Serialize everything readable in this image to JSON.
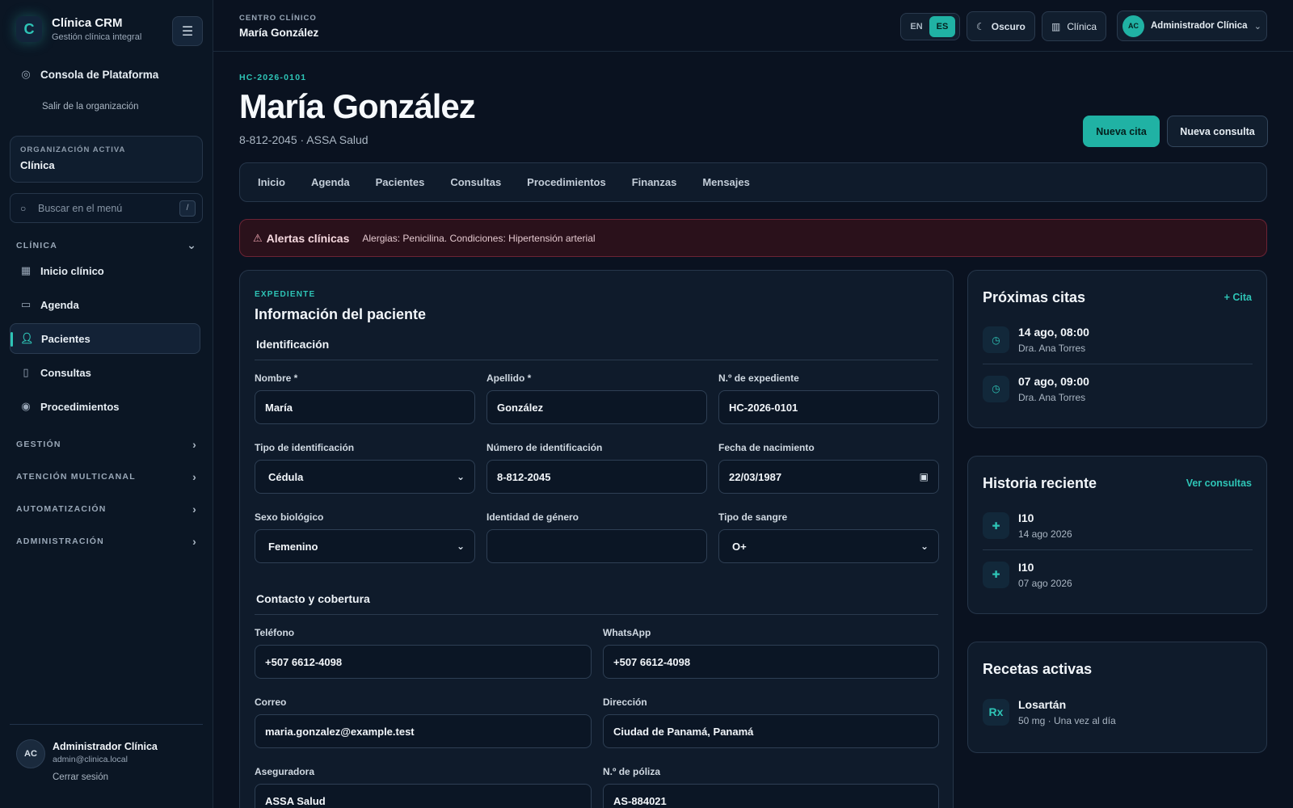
{
  "sidebar": {
    "brand_title": "Clínica CRM",
    "brand_subtitle": "Gestión clínica integral",
    "platform_console": "Consola de Plataforma",
    "leave_org": "Salir de la organización",
    "org_label": "ORGANIZACIÓN ACTIVA",
    "org_value": "Clínica",
    "search_placeholder": "Buscar en el menú",
    "search_shortcut": "/",
    "clinic_section": "CLÍNICA",
    "clinic_items": [
      {
        "label": "Inicio clínico",
        "icon": "grid-icon"
      },
      {
        "label": "Agenda",
        "icon": "calendar-icon"
      },
      {
        "label": "Pacientes",
        "icon": "user-icon"
      },
      {
        "label": "Consultas",
        "icon": "document-icon"
      },
      {
        "label": "Procedimientos",
        "icon": "check-circle-icon"
      }
    ],
    "sections": [
      "GESTIÓN",
      "ATENCIÓN MULTICANAL",
      "AUTOMATIZACIÓN",
      "ADMINISTRACIÓN"
    ],
    "user": {
      "initials": "AC",
      "name": "Administrador Clínica",
      "email": "admin@clinica.local",
      "logout": "Cerrar sesión"
    }
  },
  "topbar": {
    "kicker": "CENTRO CLÍNICO",
    "title": "María González",
    "lang_en": "EN",
    "lang_es": "ES",
    "theme_label": "Oscuro",
    "clinic_label": "Clínica",
    "user_initials": "AC",
    "user_name": "Administrador Clínica"
  },
  "patient": {
    "record": "HC-2026-0101",
    "name": "María González",
    "subtitle": "8-812-2045 · ASSA Salud",
    "new_appointment": "Nueva cita",
    "new_consultation": "Nueva consulta"
  },
  "tabs": [
    "Inicio",
    "Agenda",
    "Pacientes",
    "Consultas",
    "Procedimientos",
    "Finanzas",
    "Mensajes"
  ],
  "alert": {
    "title": "Alertas clínicas",
    "text": "Alergias: Penicilina. Condiciones: Hipertensión arterial"
  },
  "form": {
    "kicker": "EXPEDIENTE",
    "title": "Información del paciente",
    "identification": "Identificación",
    "contact": "Contacto y cobertura",
    "fields": {
      "first_name": {
        "label": "Nombre *",
        "value": "María"
      },
      "last_name": {
        "label": "Apellido *",
        "value": "González"
      },
      "record_no": {
        "label": "N.º de expediente",
        "value": "HC-2026-0101"
      },
      "id_type": {
        "label": "Tipo de identificación",
        "value": "Cédula"
      },
      "id_number": {
        "label": "Número de identificación",
        "value": "8-812-2045"
      },
      "birth_date": {
        "label": "Fecha de nacimiento",
        "value": "22/03/1987"
      },
      "sex": {
        "label": "Sexo biológico",
        "value": "Femenino"
      },
      "gender": {
        "label": "Identidad de género",
        "value": ""
      },
      "blood": {
        "label": "Tipo de sangre",
        "value": "O+"
      },
      "phone": {
        "label": "Teléfono",
        "value": "+507 6612-4098"
      },
      "whatsapp": {
        "label": "WhatsApp",
        "value": "+507 6612-4098"
      },
      "email": {
        "label": "Correo",
        "value": "maria.gonzalez@example.test"
      },
      "address": {
        "label": "Dirección",
        "value": "Ciudad de Panamá, Panamá"
      },
      "insurer": {
        "label": "Aseguradora",
        "value": "ASSA Salud"
      },
      "policy": {
        "label": "N.º de póliza",
        "value": "AS-884021"
      }
    }
  },
  "upcoming": {
    "title": "Próximas citas",
    "link": "+ Cita",
    "items": [
      {
        "when": "14 ago, 08:00",
        "doctor": "Dra. Ana Torres"
      },
      {
        "when": "07 ago, 09:00",
        "doctor": "Dra. Ana Torres"
      }
    ]
  },
  "history": {
    "title": "Historia reciente",
    "link": "Ver consultas",
    "items": [
      {
        "code": "I10",
        "date": "14 ago 2026"
      },
      {
        "code": "I10",
        "date": "07 ago 2026"
      }
    ]
  },
  "prescriptions": {
    "title": "Recetas activas",
    "icon_label": "Rx",
    "items": [
      {
        "name": "Losartán",
        "dose": "50 mg · Una vez al día"
      }
    ]
  },
  "colors": {
    "accent": "#20b2a4",
    "background": "#0a1220",
    "alert": "#2a111b"
  }
}
